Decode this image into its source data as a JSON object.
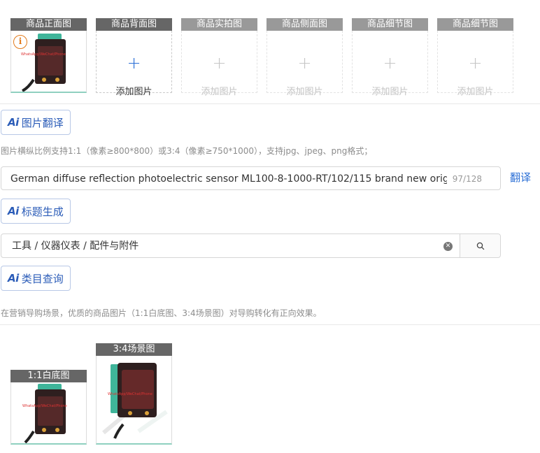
{
  "image_slots": [
    {
      "label": "商品正面图",
      "state": "filled",
      "add_text": ""
    },
    {
      "label": "商品背面图",
      "state": "empty",
      "add_text": "添加图片"
    },
    {
      "label": "商品实拍图",
      "state": "disabled",
      "add_text": "添加图片"
    },
    {
      "label": "商品侧面图",
      "state": "disabled",
      "add_text": "添加图片"
    },
    {
      "label": "商品细节图",
      "state": "disabled",
      "add_text": "添加图片"
    },
    {
      "label": "商品细节图",
      "state": "disabled",
      "add_text": "添加图片"
    }
  ],
  "plus_glyph": "+",
  "ai_buttons": {
    "image_translate": "图片翻译",
    "title_generate": "标题生成",
    "category_query": "类目查询"
  },
  "image_hint": "图片横纵比例支持1:1（像素≥800*800）或3:4（像素≥750*1000），支持jpg、jpeg、png格式；",
  "title_field": {
    "value": "German diffuse reflection photoelectric sensor ML100-8-1000-RT/102/115 brand new original",
    "count": "97/128"
  },
  "translate_label": "翻译",
  "category_field": {
    "value": "工具 / 仪器仪表 / 配件与附件"
  },
  "scene_hint": "在营销导购场景，优质的商品图片（1:1白底图、3:4场景图）对导购转化有正向效果。",
  "scene_images": [
    {
      "label": "1:1白底图"
    },
    {
      "label": "3:4场景图"
    }
  ],
  "colors": {
    "accent": "#2b6fd6",
    "slot_header": "#666666",
    "info": "#e27b1c",
    "sensor_body": "#3a2424",
    "sensor_teal": "#3fb59a"
  }
}
